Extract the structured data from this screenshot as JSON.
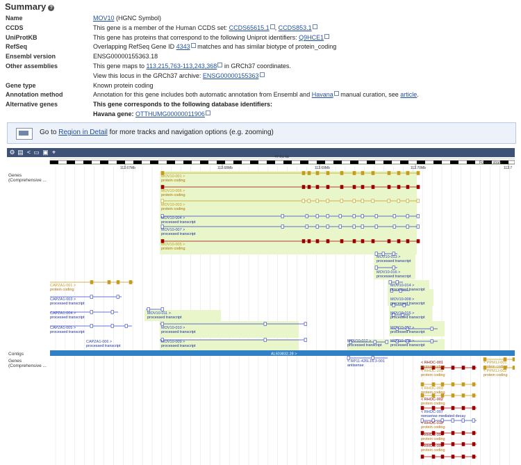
{
  "summary": {
    "title": "Summary",
    "help_icon": "question-icon",
    "rows": {
      "name": {
        "key": "Name",
        "link": "MOV10",
        "rest": " (HGNC Symbol)"
      },
      "ccds": {
        "key": "CCDS",
        "pre": "This gene is a member of the Human CCDS set: ",
        "link1": "CCDS65615.1",
        "sep": ", ",
        "link2": "CCDS853.1"
      },
      "uniprot": {
        "key": "UniProtKB",
        "pre": "This gene has proteins that correspond to the following Uniprot identifiers: ",
        "link": "Q9HCE1"
      },
      "refseq": {
        "key": "RefSeq",
        "pre": "Overlapping RefSeq Gene ID ",
        "link": "4343",
        "rest": " matches and has similar biotype of protein_coding"
      },
      "ensembl": {
        "key": "Ensembl version",
        "value": "ENSG00000155363.18"
      },
      "assemblies": {
        "key": "Other assemblies",
        "pre": "This gene maps to ",
        "link": "113,215,763-113,243,368",
        "rest": " in GRCh37 coordinates.",
        "line2_pre": "View this locus in the GRCh37 archive: ",
        "line2_link": "ENSG00000155363"
      },
      "gene_type": {
        "key": "Gene type",
        "value": "Known protein coding"
      },
      "annotation": {
        "key": "Annotation method",
        "pre": "Annotation for this gene includes both automatic annotation from Ensembl and ",
        "link1": "Havana",
        "mid": " manual curation, see ",
        "link2": "article",
        "end": "."
      },
      "alt": {
        "key": "Alternative genes",
        "bold": "This gene corresponds to the following database identifiers:",
        "havana_label": "Havana gene: ",
        "havana_link": "OTTHUMG00000011906"
      }
    }
  },
  "goto_bar": {
    "pre": "Go to ",
    "link": "Region in Detail",
    "rest": " for more tracks and navigation options (e.g. zooming)"
  },
  "toolbar_icons": [
    "gear-icon",
    "export-icon",
    "share-icon",
    "resize-icon",
    "image-icon",
    "locate-icon"
  ],
  "ruler": {
    "span": "47.61 kb",
    "strand": "Forward strand",
    "ticks": [
      "112.67Mb",
      "112.68Mb",
      "112.69Mb",
      "112.70Mb",
      "112.7"
    ]
  },
  "tracks": {
    "genes_label": "Genes",
    "comp_label": "(Comprehensive ...",
    "contigs_label": "Contigs",
    "contig_name": "AL603832.28 >"
  },
  "transcripts": [
    {
      "name": "MOV10-001 >",
      "type": "protein coding"
    },
    {
      "name": "MOV10-006 >",
      "type": "protein coding"
    },
    {
      "name": "MOV10-003 >",
      "type": "protein coding"
    },
    {
      "name": "MOV10-004 >",
      "type": "processed transcript"
    },
    {
      "name": "MOV10-007 >",
      "type": "processed transcript"
    },
    {
      "name": "MOV10-005 >",
      "type": "protein coding"
    },
    {
      "name": "MOV10-013 >",
      "type": "processed transcript"
    },
    {
      "name": "MOV10-016 >",
      "type": "processed transcript"
    },
    {
      "name": "CAPZA1-001 >",
      "type": "protein coding"
    },
    {
      "name": "MOV10-014 >",
      "type": "processed transcript"
    },
    {
      "name": "CAPZA1-003 >",
      "type": "processed transcript"
    },
    {
      "name": "MOV10-008 >",
      "type": "processed transcript"
    },
    {
      "name": "CAPZA1-004 >",
      "type": "processed transcript"
    },
    {
      "name": "MOV10-011 >",
      "type": "processed transcript"
    },
    {
      "name": "MOV10-015 >",
      "type": "processed transcript"
    },
    {
      "name": "CAPZA1-005 >",
      "type": "processed transcript"
    },
    {
      "name": "MOV10-010 >",
      "type": "processed transcript"
    },
    {
      "name": "MOV10-017 >",
      "type": "processed transcript"
    },
    {
      "name": "CAPZA1-006 >",
      "type": "processed transcript"
    },
    {
      "name": "MOV10-009 >",
      "type": "processed transcript"
    },
    {
      "name": "MOV10-012 >",
      "type": "processed transcript"
    },
    {
      "name": "MOV10-018 >",
      "type": "processed transcript"
    }
  ],
  "reverse_genes": [
    {
      "name": "< RP11-426L16.3-001",
      "type": "antisense"
    },
    {
      "name": "< RHOC-001",
      "type": "protein coding"
    },
    {
      "name": "< RHOC-201",
      "type": "protein coding"
    },
    {
      "name": "< RHOC-003",
      "type": "protein coding"
    },
    {
      "name": "< RHOC-002",
      "type": "protein coding"
    },
    {
      "name": "< RHOC-007",
      "type": "nonsense mediated decay"
    },
    {
      "name": "< RHOC-012",
      "type": "protein coding"
    },
    {
      "name": "< RHOC-004",
      "type": "protein coding"
    },
    {
      "name": "< RHOC-005",
      "type": "protein coding"
    },
    {
      "name": "< PPM1J-001",
      "type": "protein coding"
    },
    {
      "name": "< PPM1J-002",
      "type": "protein coding"
    }
  ],
  "colors": {
    "protein_coding": "#9b0000",
    "gold": "#c59a1e",
    "processed": "#3042c0",
    "highlight": "#e8f6c9",
    "contig": "#2f80c4",
    "toolbar": "#3e5176"
  }
}
